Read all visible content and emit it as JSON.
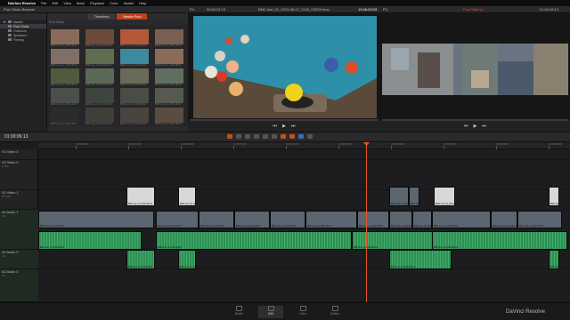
{
  "menubar": {
    "apple_glyph": "",
    "app_name": "DaVinci Resolve",
    "items": [
      "File",
      "Edit",
      "View",
      "Mark",
      "Playback",
      "Color",
      "Nodes",
      "Help"
    ]
  },
  "topbar": {
    "left_title": "Pool Shots Browser",
    "source_label": "PV",
    "source_timecode": "00:00:01:10",
    "source_clip": "BMC test_01_2013-08-17_1240_C0000.mov",
    "record_timecode": "13:46:23:03",
    "record_label": "PV",
    "timeline_name": "Pool Shot v1",
    "record_timecode_right": "01:00:06:13"
  },
  "library": {
    "items": [
      {
        "label": "Master",
        "selected": false
      },
      {
        "label": "Pool Shots",
        "selected": true
      },
      {
        "label": "Outdoors",
        "selected": false
      },
      {
        "label": "Speakers",
        "selected": false
      },
      {
        "label": "Fishing",
        "selected": false
      }
    ]
  },
  "media_pool": {
    "tab_timelines": "Timelines",
    "tab_media_pool": "Media Pool",
    "folder_label": "Pool Shots",
    "thumbnails": [
      {
        "caption": "BMC test_01_2013-08-17",
        "color": "#8a6a5a"
      },
      {
        "caption": "BMC test_01_2013-08-17",
        "color": "#6e4a3a"
      },
      {
        "caption": "BMC test_01_2013-08-17",
        "color": "#b4583a"
      },
      {
        "caption": "BMC test_01_2013-08-17",
        "color": "#7a6050"
      },
      {
        "caption": "BMC test_01_2013-08-17",
        "color": "#7f6f66"
      },
      {
        "caption": "BMC test_01_2013-08-17",
        "color": "#5d6d4d"
      },
      {
        "caption": "BMC test_01_2013-08-17",
        "color": "#3d8a9e"
      },
      {
        "caption": "BMC test_01_2013-08-17",
        "color": "#8a6b58"
      },
      {
        "caption": "BMC test_01_2013-08-17",
        "color": "#4f5a3f"
      },
      {
        "caption": "BMC test_01_2013-08-17",
        "color": "#5a6a55"
      },
      {
        "caption": "BMC test_01_2013-08-17",
        "color": "#6a6a5a"
      },
      {
        "caption": "BMC test_01_2013-08-17",
        "color": "#5f6f5f"
      },
      {
        "caption": "BMC test_01_2013-08-17",
        "color": "#4a4f4a"
      },
      {
        "caption": "BMC test_01_2013-08-17",
        "color": "#3e443e"
      },
      {
        "caption": "BMC test_01_2013-08-17",
        "color": "#4a4d45"
      },
      {
        "caption": "BMC test_01_2013-08-17",
        "color": "#56594f"
      },
      {
        "caption": "BMC test_01_2013-08-17",
        "color": "#2a2c2a"
      },
      {
        "caption": "BMC test_01_2013-08-17",
        "color": "#3f3f3a"
      },
      {
        "caption": "BMC test_01_2013-08-17",
        "color": "#4a4440"
      },
      {
        "caption": "BMC test_01_2013-08-17",
        "color": "#5a4c40"
      }
    ]
  },
  "toolbar": {
    "timecode": "01:00:06:13"
  },
  "ruler": {
    "ticks": [
      "01:00:00:00",
      "01:00:01:00",
      "01:00:02:00",
      "01:00:03:00",
      "01:00:04:00",
      "01:00:05:00",
      "01:00:06:00",
      "01:00:07:00",
      "01:00:08:00",
      "01:00:09:00"
    ]
  },
  "tracks": [
    {
      "id": "V3",
      "name": "Video 3",
      "sub": ""
    },
    {
      "id": "V2",
      "name": "Video 2",
      "sub": "1 Clip"
    },
    {
      "id": "V1",
      "name": "Video 1",
      "sub": "15 Clips"
    },
    {
      "id": "A1",
      "name": "Audio 1",
      "sub": "2.0"
    },
    {
      "id": "A2",
      "name": "Audio 2",
      "sub": "2.0"
    },
    {
      "id": "A3",
      "name": "Audio 3",
      "sub": "2.0"
    }
  ],
  "clip_label": "BMC test_01_2013-08-17",
  "pages": [
    {
      "label": "Media",
      "active": false
    },
    {
      "label": "Edit",
      "active": true
    },
    {
      "label": "Color",
      "active": false
    },
    {
      "label": "Deliver",
      "active": false
    }
  ],
  "brand": "DaVinci Resolve",
  "colors": {
    "accent": "#c0401a",
    "playhead": "#e0582a",
    "audio_clip": "#2f8f55",
    "video_clip": "#5c6670"
  }
}
